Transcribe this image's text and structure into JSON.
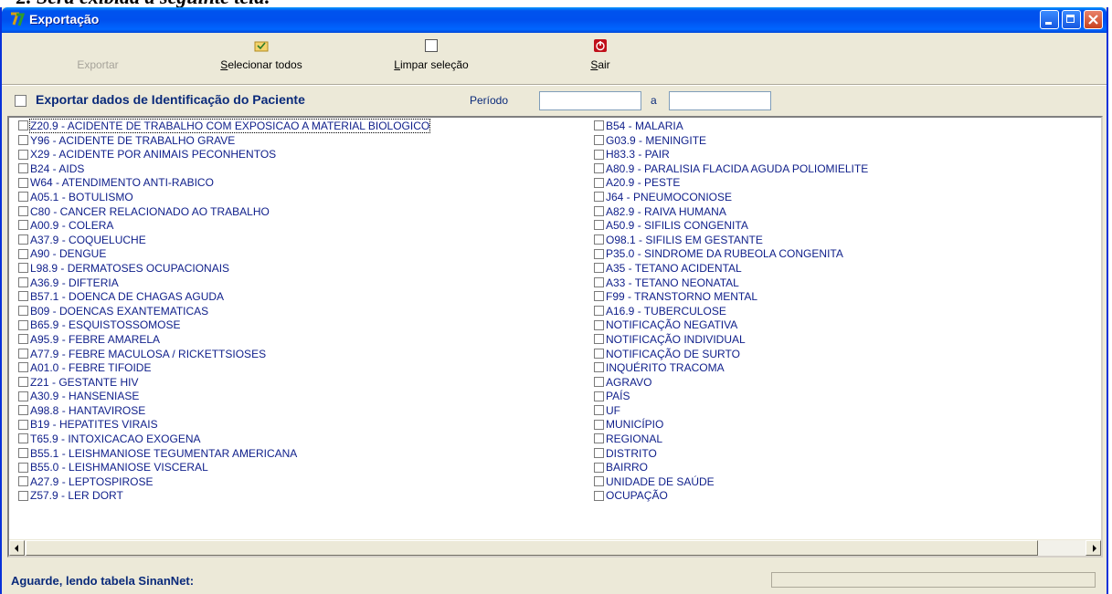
{
  "doc_caption": "2.  Será exibida a seguinte tela:",
  "window": {
    "title": "Exportação"
  },
  "toolbar": {
    "export_label": "Exportar",
    "select_all_first": "S",
    "select_all_rest": "elecionar todos",
    "clear_first": "L",
    "clear_rest": "impar seleção",
    "exit_first": "S",
    "exit_rest": "air"
  },
  "options": {
    "export_patient_label": "Exportar dados de Identificação do Paciente",
    "period_label": "Período",
    "period_start": "",
    "period_to_label": "a",
    "period_end": ""
  },
  "list_left": [
    "Z20.9 - ACIDENTE DE TRABALHO COM EXPOSICAO A MATERIAL BIOLOGICO",
    "Y96 - ACIDENTE DE TRABALHO GRAVE",
    "X29 - ACIDENTE POR ANIMAIS PECONHENTOS",
    "B24 - AIDS",
    "W64 - ATENDIMENTO ANTI-RABICO",
    "A05.1 - BOTULISMO",
    "C80 - CANCER RELACIONADO AO TRABALHO",
    "A00.9 - COLERA",
    "A37.9 - COQUELUCHE",
    "A90 - DENGUE",
    "L98.9 - DERMATOSES OCUPACIONAIS",
    "A36.9 - DIFTERIA",
    "B57.1 - DOENCA DE CHAGAS AGUDA",
    "B09 - DOENCAS EXANTEMATICAS",
    "B65.9 - ESQUISTOSSOMOSE",
    "A95.9 - FEBRE AMARELA",
    "A77.9 - FEBRE MACULOSA / RICKETTSIOSES",
    "A01.0 - FEBRE TIFOIDE",
    "Z21 - GESTANTE HIV",
    "A30.9 - HANSENIASE",
    "A98.8 - HANTAVIROSE",
    "B19 - HEPATITES VIRAIS",
    "T65.9 - INTOXICACAO EXOGENA",
    "B55.1 - LEISHMANIOSE TEGUMENTAR AMERICANA",
    "B55.0 - LEISHMANIOSE VISCERAL",
    "A27.9 - LEPTOSPIROSE",
    "Z57.9 - LER DORT"
  ],
  "list_right": [
    "B54 - MALARIA",
    "G03.9 - MENINGITE",
    "H83.3 - PAIR",
    "A80.9 - PARALISIA FLACIDA AGUDA  POLIOMIELITE",
    "A20.9 - PESTE",
    "J64 - PNEUMOCONIOSE",
    "A82.9 - RAIVA HUMANA",
    "A50.9 - SIFILIS CONGENITA",
    "O98.1 - SIFILIS EM GESTANTE",
    "P35.0 - SINDROME DA RUBEOLA CONGENITA",
    "A35 - TETANO ACIDENTAL",
    "A33 - TETANO NEONATAL",
    "F99 - TRANSTORNO MENTAL",
    "A16.9 - TUBERCULOSE",
    "NOTIFICAÇÃO NEGATIVA",
    "NOTIFICAÇÃO INDIVIDUAL",
    "NOTIFICAÇÃO DE SURTO",
    "INQUÉRITO TRACOMA",
    "AGRAVO",
    "PAÍS",
    "UF",
    "MUNICÍPIO",
    "REGIONAL",
    "DISTRITO",
    "BAIRRO",
    "UNIDADE DE SAÚDE",
    "OCUPAÇÃO"
  ],
  "status": {
    "text": "Aguarde, lendo tabela SinanNet:",
    "progress": 0
  },
  "colors": {
    "title_blue": "#0054e3",
    "window_bg": "#ece9d8",
    "list_text": "#0e1e8a",
    "label_text": "#0a2a7a"
  }
}
